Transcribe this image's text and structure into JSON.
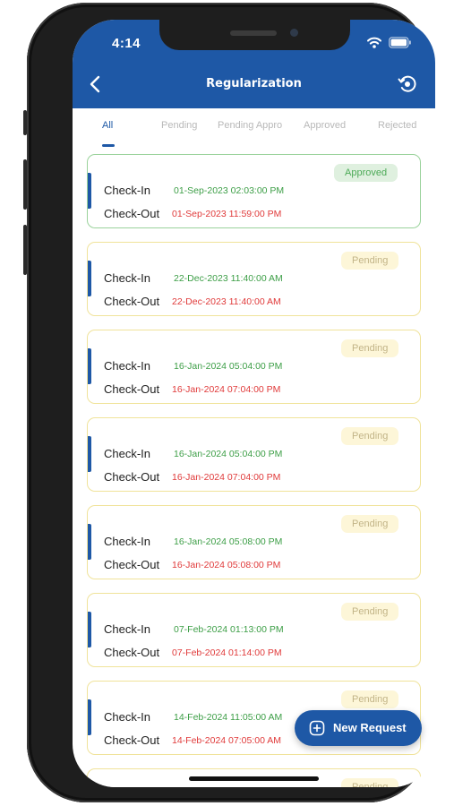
{
  "status_bar": {
    "time": "4:14"
  },
  "header": {
    "title": "Regularization"
  },
  "tabs": [
    {
      "label": "All",
      "active": true
    },
    {
      "label": "Pending",
      "active": false
    },
    {
      "label": "Pending Appro",
      "active": false
    },
    {
      "label": "Approved",
      "active": false
    },
    {
      "label": "Rejected",
      "active": false
    }
  ],
  "labels": {
    "check_in": "Check-In",
    "check_out": "Check-Out"
  },
  "records": [
    {
      "status": "Approved",
      "check_in": "01-Sep-2023 02:03:00 PM",
      "check_out": "01-Sep-2023 11:59:00 PM"
    },
    {
      "status": "Pending",
      "check_in": "22-Dec-2023 11:40:00 AM",
      "check_out": "22-Dec-2023 11:40:00 AM"
    },
    {
      "status": "Pending",
      "check_in": "16-Jan-2024 05:04:00 PM",
      "check_out": "16-Jan-2024 07:04:00 PM"
    },
    {
      "status": "Pending",
      "check_in": "16-Jan-2024 05:04:00 PM",
      "check_out": "16-Jan-2024 07:04:00 PM"
    },
    {
      "status": "Pending",
      "check_in": "16-Jan-2024 05:08:00 PM",
      "check_out": "16-Jan-2024 05:08:00 PM"
    },
    {
      "status": "Pending",
      "check_in": "07-Feb-2024 01:13:00 PM",
      "check_out": "07-Feb-2024 01:14:00 PM"
    },
    {
      "status": "Pending",
      "check_in": "14-Feb-2024 11:05:00 AM",
      "check_out": "14-Feb-2024 07:05:00 AM"
    },
    {
      "status": "Pending",
      "check_in": "",
      "check_out": ""
    }
  ],
  "fab": {
    "label": "New Request"
  },
  "colors": {
    "brand": "#1e58a6",
    "check_in": "#3c9e46",
    "check_out": "#e03a3a",
    "approved_bg": "#dff0df",
    "pending_bg": "#fdf6d8"
  },
  "icons": {
    "back": "chevron-left-icon",
    "history": "history-icon",
    "fab": "plus-square-icon",
    "wifi": "wifi-icon",
    "battery": "battery-icon"
  }
}
